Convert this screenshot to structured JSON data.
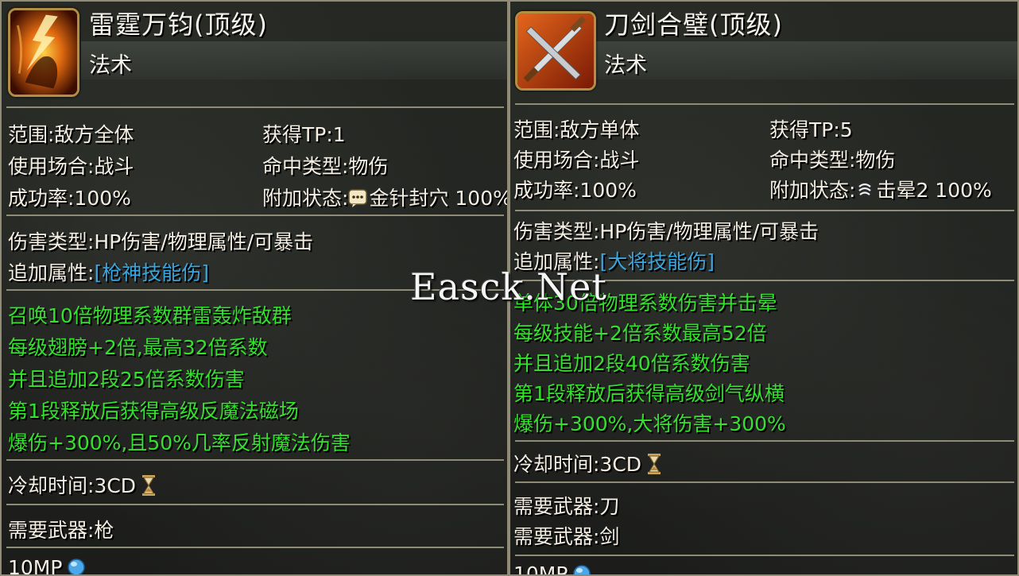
{
  "left": {
    "name": "雷霆万钧(顶级)",
    "type": "法术",
    "icon": "lightning-warrior-icon",
    "range": "范围:敌方全体",
    "tp": "获得TP:1",
    "usage": "使用场合:战斗",
    "hit_type": "命中类型:物伤",
    "success": "成功率:100%",
    "extra_status_label": "附加状态:",
    "extra_status_icon": "speech-bubble-icon",
    "extra_status_value": "金针封穴 100%",
    "damage_type": "伤害类型:HP伤害/物理属性/可暴击",
    "extra_attr_label": "追加属性:",
    "extra_attr_value": "[枪神技能伤]",
    "desc": [
      "召唤10倍物理系数群雷轰炸敌群",
      "每级翅膀+2倍,最高32倍系数",
      "并且追加2段25倍系数伤害",
      "第1段释放后获得高级反魔法磁场",
      "爆伤+300%,且50%几率反射魔法伤害"
    ],
    "cooldown": "冷却时间:3CD",
    "weapons": [
      "需要武器:枪"
    ],
    "mp": "10MP"
  },
  "right": {
    "name": "刀剑合璧(顶级)",
    "type": "法术",
    "icon": "crossed-blades-icon",
    "range": "范围:敌方单体",
    "tp": "获得TP:5",
    "usage": "使用场合:战斗",
    "hit_type": "命中类型:物伤",
    "success": "成功率:100%",
    "extra_status_label": "附加状态:",
    "extra_status_icon": "stun-swirl-icon",
    "extra_status_value": "击晕2 100%",
    "damage_type": "伤害类型:HP伤害/物理属性/可暴击",
    "extra_attr_label": "追加属性:",
    "extra_attr_value": "[大将技能伤]",
    "desc": [
      "单体30倍物理系数伤害并击晕",
      "每级技能+2倍系数最高52倍",
      "并且追加2段40倍系数伤害",
      "第1段释放后获得高级剑气纵横",
      "爆伤+300%,大将伤害+300%"
    ],
    "cooldown": "冷却时间:3CD",
    "weapons": [
      "需要武器:刀",
      "需要武器:剑"
    ],
    "mp": "10MP"
  },
  "watermark": "Easck.Net",
  "colors": {
    "label": "#f4efe2",
    "attr_blue": "#39a6dd",
    "desc_green": "#35e12e",
    "frame_gold": "#b28d43",
    "divider": "#8e8b77"
  }
}
